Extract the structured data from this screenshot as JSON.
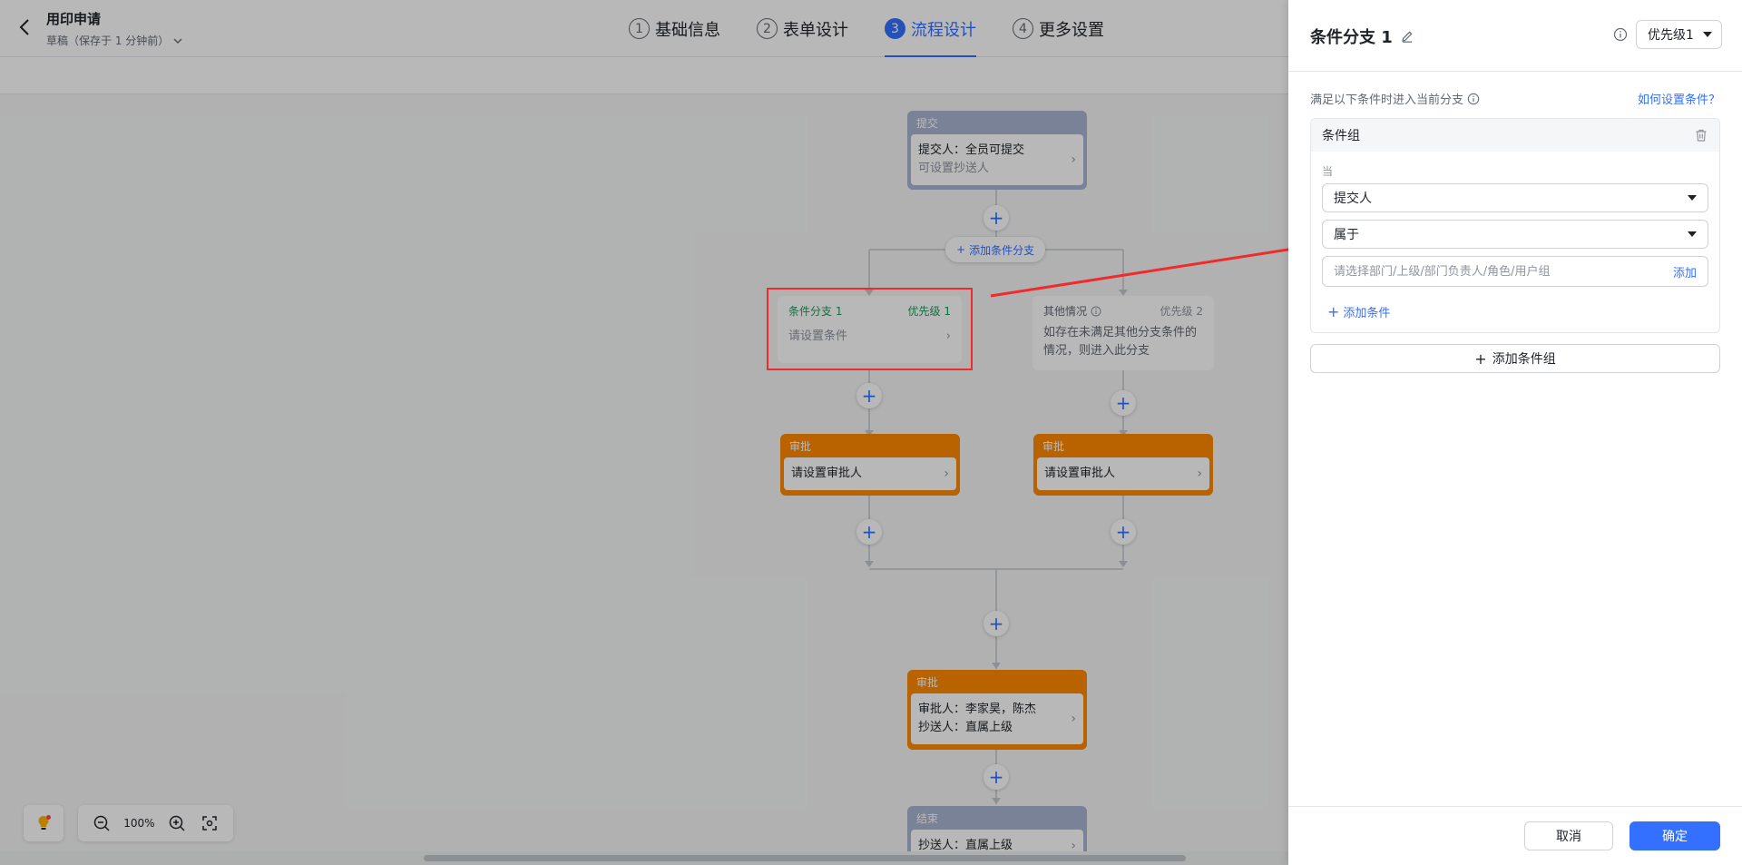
{
  "header": {
    "title": "用印申请",
    "subtitle": "草稿（保存于 1 分钟前）",
    "steps": [
      {
        "num": "1",
        "label": "基础信息"
      },
      {
        "num": "2",
        "label": "表单设计"
      },
      {
        "num": "3",
        "label": "流程设计"
      },
      {
        "num": "4",
        "label": "更多设置"
      }
    ],
    "active_step": 3,
    "accent_color": "#3370ff"
  },
  "flow": {
    "submit": {
      "head": "提交",
      "line1": "提交人：全员可提交",
      "line2": "可设置抄送人"
    },
    "add_branch_label": "添加条件分支",
    "branch1": {
      "name": "条件分支 1",
      "priority": "优先级 1",
      "text": "请设置条件"
    },
    "branch2": {
      "name": "其他情况",
      "priority": "优先级 2",
      "text": "如存在未满足其他分支条件的情况，则进入此分支"
    },
    "approve_left": {
      "head": "审批",
      "text": "请设置审批人"
    },
    "approve_right": {
      "head": "审批",
      "text": "请设置审批人"
    },
    "approve_main": {
      "head": "审批",
      "line1": "审批人：李家昊，陈杰",
      "line2": "抄送人：直属上级"
    },
    "end": {
      "head": "结束",
      "line1": "抄送人：直属上级"
    },
    "approve_color": "#ff8800",
    "branch_color": "#1a9a5c"
  },
  "zoom": {
    "value": "100%"
  },
  "panel": {
    "title": "条件分支 1",
    "priority": "优先级1",
    "hint": "满足以下条件时进入当前分支",
    "help_link": "如何设置条件？",
    "group": {
      "title": "条件组",
      "when_label": "当",
      "field": "提交人",
      "operator": "属于",
      "input_placeholder": "请选择部门/上级/部门负责人/角色/用户组",
      "input_add": "添加",
      "add_condition": "添加条件"
    },
    "add_group": "添加条件组",
    "cancel": "取消",
    "confirm": "确定"
  }
}
